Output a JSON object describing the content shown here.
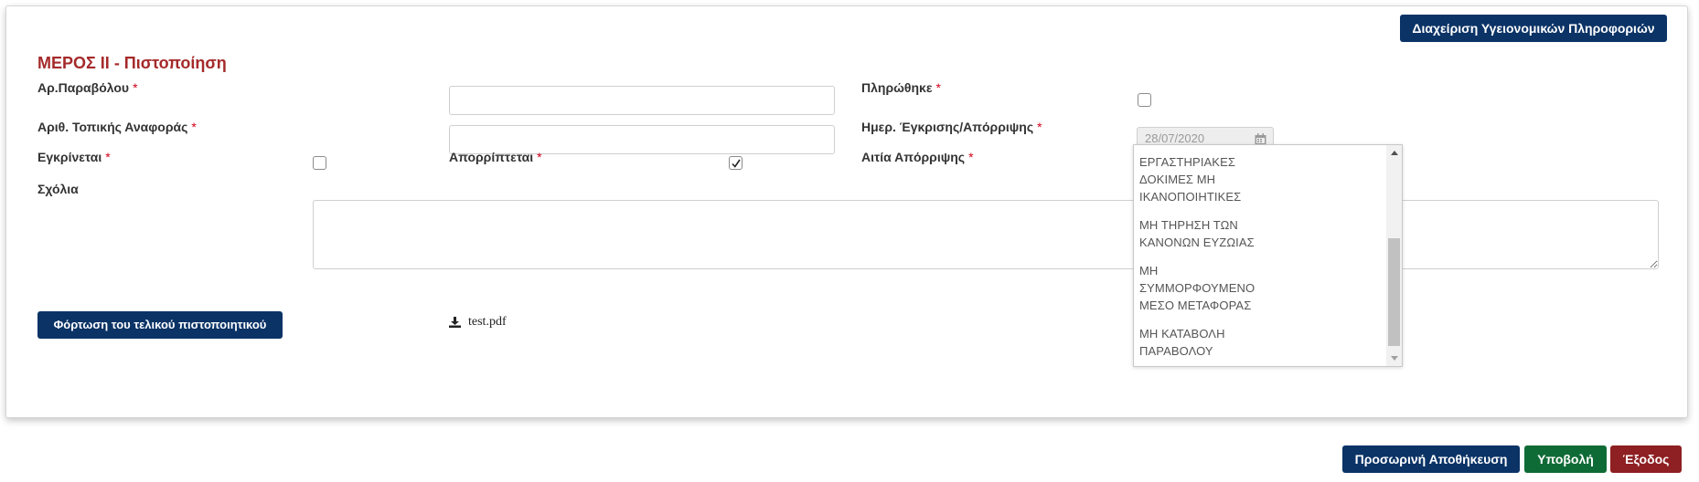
{
  "header": {
    "health_info_button": "Διαχείριση Υγειονομικών Πληροφοριών"
  },
  "section": {
    "title": "ΜΕΡΟΣ ΙΙ - Πιστοποίηση"
  },
  "form": {
    "fee_number_label": "Αρ.Παραβόλου",
    "fee_number_value": "",
    "paid_label": "Πληρώθηκε",
    "paid_checked": false,
    "local_ref_label": "Αριθ. Τοπικής Αναφοράς",
    "local_ref_value": "",
    "decision_date_label": "Ημερ. Έγκρισης/Απόρριψης",
    "decision_date_value": "28/07/2020",
    "approved_label": "Εγκρίνεται",
    "approved_checked": false,
    "rejected_label": "Απορρίπτεται",
    "rejected_checked": true,
    "rejection_reason_label": "Αιτία Απόρριψης",
    "comments_label": "Σχόλια",
    "comments_value": "",
    "required_mark": "*"
  },
  "rejection_reasons": [
    "ΕΡΓΑΣΤΗΡΙΑΚΕΣ ΔΟΚΙΜΕΣ ΜΗ ΙΚΑΝΟΠΟΙΗΤΙΚΕΣ",
    "ΜΗ ΤΗΡΗΣΗ ΤΩΝ ΚΑΝΟΝΩΝ ΕΥΖΩΙΑΣ",
    "ΜΗ ΣΥΜΜΟΡΦΟΥΜΕΝΟ ΜΕΣΟ ΜΕΤΑΦΟΡΑΣ",
    "ΜΗ ΚΑΤΑΒΟΛΗ ΠΑΡΑΒΟΛΟΥ"
  ],
  "upload": {
    "button_label": "Φόρτωση του τελικού πιστοποιητικού",
    "file_name": "test.pdf",
    "file_icon": "download-icon"
  },
  "footer": {
    "save_draft_label": "Προσωρινή Αποθήκευση",
    "submit_label": "Υποβολή",
    "exit_label": "Έξοδος"
  },
  "colors": {
    "navy": "#0b3366",
    "green": "#0f6b36",
    "red": "#8e1f22",
    "title_red": "#a52a2a",
    "required_red": "#d0021b"
  }
}
